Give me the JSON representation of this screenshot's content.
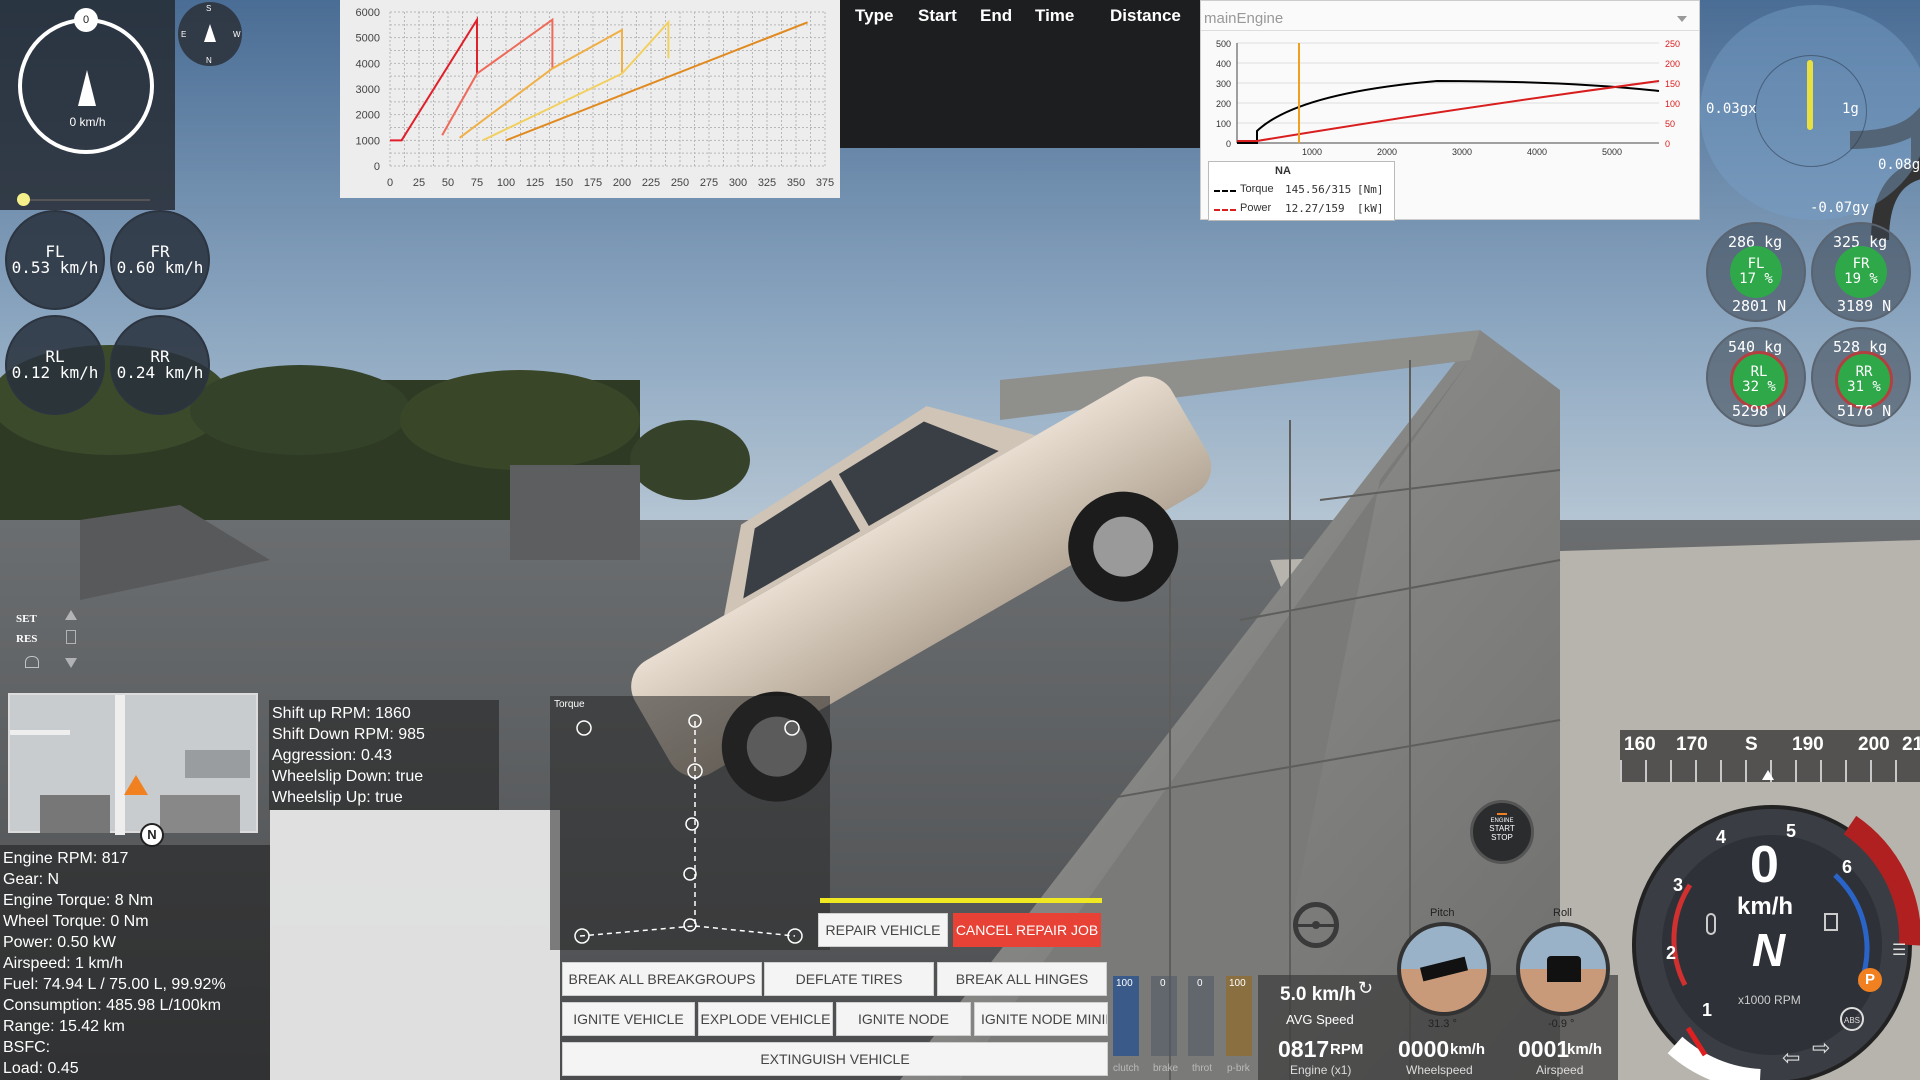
{
  "compass": {
    "speed": "0 km/h",
    "top_mark": "0"
  },
  "mini_compass": {
    "n": "N",
    "s": "S",
    "e": "E",
    "w": "W"
  },
  "wheel_speeds": [
    {
      "id": "FL",
      "speed": "0.53 km/h"
    },
    {
      "id": "FR",
      "speed": "0.60 km/h"
    },
    {
      "id": "RL",
      "speed": "0.12 km/h"
    },
    {
      "id": "RR",
      "speed": "0.24 km/h"
    }
  ],
  "cruise": {
    "set": "SET",
    "res": "RES"
  },
  "shift_chart": {
    "type": "line",
    "yticks": [
      "6000",
      "5000",
      "4000",
      "3000",
      "2000",
      "1000",
      "0"
    ],
    "xticks": [
      "0",
      "25",
      "50",
      "75",
      "100",
      "125",
      "150",
      "175",
      "200",
      "225",
      "250",
      "275",
      "300",
      "325",
      "350",
      "375"
    ],
    "ylim": [
      0,
      6000
    ],
    "xlim": [
      0,
      375
    ],
    "series": [
      {
        "color": "#e0202a",
        "points": [
          [
            0,
            1000
          ],
          [
            10,
            1000
          ],
          [
            75,
            5700
          ],
          [
            75,
            3600
          ],
          [
            75,
            3600
          ]
        ]
      },
      {
        "color": "#ee6a5a",
        "points": [
          [
            45,
            1200
          ],
          [
            75,
            3600
          ],
          [
            140,
            5700
          ],
          [
            140,
            3800
          ]
        ]
      },
      {
        "color": "#f0b048",
        "points": [
          [
            60,
            1100
          ],
          [
            140,
            3800
          ],
          [
            200,
            5300
          ],
          [
            200,
            3600
          ]
        ]
      },
      {
        "color": "#f2d060",
        "points": [
          [
            80,
            1000
          ],
          [
            200,
            3600
          ],
          [
            240,
            5600
          ],
          [
            240,
            4200
          ]
        ]
      },
      {
        "color": "#e08a20",
        "points": [
          [
            100,
            1000
          ],
          [
            360,
            5600
          ]
        ]
      }
    ]
  },
  "trip_table": {
    "headers": [
      "Type",
      "Start",
      "End",
      "Time",
      "Distance"
    ]
  },
  "engine_graph": {
    "dropdown": "mainEngine",
    "left_ticks": [
      "500",
      "400",
      "300",
      "200",
      "100",
      "0"
    ],
    "right_ticks": [
      "250",
      "200",
      "150",
      "100",
      "50",
      "0"
    ],
    "x_ticks": [
      "1000",
      "2000",
      "3000",
      "4000",
      "5000"
    ],
    "aspiration": "NA",
    "torque_label": "Torque",
    "torque_value": "145.56/315",
    "torque_unit": "[Nm]",
    "power_label": "Power",
    "power_value": "12.27/159",
    "power_unit": "[kW]",
    "torque_color": "#000000",
    "power_color": "#d81e1e",
    "rpm_marker_color": "#f0a020"
  },
  "gforce": {
    "x": "0.03gx",
    "center": "1g",
    "right": "0.08g",
    "y": "-0.07gy"
  },
  "tire_loads": [
    {
      "id": "FL",
      "kg": "286 kg",
      "pct": "17 %",
      "n": "2801 N"
    },
    {
      "id": "FR",
      "kg": "325 kg",
      "pct": "19 %",
      "n": "3189 N"
    },
    {
      "id": "RL",
      "kg": "540 kg",
      "pct": "32 %",
      "n": "5298 N"
    },
    {
      "id": "RR",
      "kg": "528 kg",
      "pct": "31 %",
      "n": "5176 N"
    }
  ],
  "transmission": {
    "lines": [
      "Shift up RPM: 1860",
      "Shift Down RPM: 985",
      "Aggression: 0.43",
      "Wheelslip Down: true",
      "Wheelslip Up: true"
    ]
  },
  "engine_info": {
    "lines": [
      "Engine RPM: 817",
      "Gear: N",
      "Engine Torque: 8 Nm",
      "Wheel Torque: 0 Nm",
      "Power: 0.50 kW",
      "Airspeed: 1 km/h",
      "Fuel: 74.94 L / 75.00 L, 99.92%",
      "Consumption: 485.98 L/100km",
      "Range: 15.42 km",
      "BSFC:",
      "Load: 0.45"
    ]
  },
  "minimap": {
    "gear_marker": "N"
  },
  "torque_tree": {
    "title": "Torque"
  },
  "repair": {
    "repair": "REPAIR VEHICLE",
    "cancel": "CANCEL REPAIR JOB"
  },
  "actions": {
    "row1": [
      "BREAK ALL BREAKGROUPS",
      "DEFLATE TIRES",
      "BREAK ALL HINGES"
    ],
    "row2": [
      "IGNITE VEHICLE",
      "EXPLODE VEHICLE",
      "IGNITE NODE",
      "IGNITE NODE MINIM"
    ],
    "row3": [
      "EXTINGUISH VEHICLE"
    ]
  },
  "pedals": [
    {
      "label": "clutch",
      "value": "100",
      "level": 1.0,
      "color": "#3a5a8a"
    },
    {
      "label": "brake",
      "value": "0",
      "level": 0.0,
      "color": "#8a3a3a"
    },
    {
      "label": "throt",
      "value": "0",
      "level": 0.0,
      "color": "#3a8a3a"
    },
    {
      "label": "p-brk",
      "value": "100",
      "level": 1.0,
      "color": "#8a7040"
    }
  ],
  "readouts": {
    "avg_speed": "5.0 km/h",
    "avg_label": "AVG Speed",
    "rpm": "0817",
    "rpm_unit": "RPM",
    "rpm_label": "Engine (x1)",
    "wheelspeed": "0000",
    "wheelspeed_unit": "km/h",
    "wheelspeed_label": "Wheelspeed",
    "airspeed": "0001",
    "airspeed_unit": "km/h",
    "airspeed_label": "Airspeed"
  },
  "attitude": {
    "pitch_label": "Pitch",
    "pitch_value": "31.3 °",
    "roll_label": "Roll",
    "roll_value": "-0.9 °"
  },
  "start_stop": {
    "l1": "ENGINE",
    "l2": "START",
    "l3": "STOP"
  },
  "heading_tape": {
    "labels": [
      "160",
      "170",
      "S",
      "190",
      "200",
      "21"
    ]
  },
  "dash": {
    "speed": "0",
    "unit": "km/h",
    "gear": "N",
    "rpm_unit": "x1000 RPM",
    "rpm_ticks": [
      "1",
      "2",
      "3",
      "4",
      "5",
      "6"
    ],
    "parking": "P",
    "abs": "ABS"
  }
}
